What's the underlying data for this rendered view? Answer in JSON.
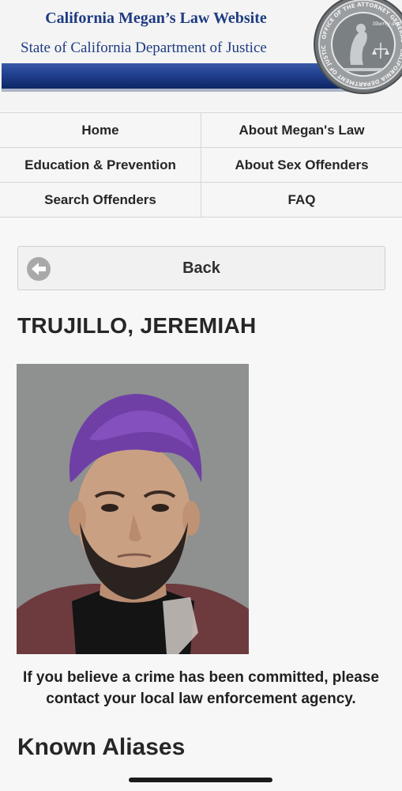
{
  "header": {
    "title": "California Megan’s Law Website",
    "subtitle": "State of California Department of Justice",
    "seal_icon": "attorney-general-seal-icon",
    "seal_ring_text": "OFFICE OF THE ATTORNEY GENERAL · CALIFORNIA DEPARTMENT OF JUSTICE",
    "seal_motto": "liberty and justice under law"
  },
  "nav": {
    "items": [
      {
        "label": "Home"
      },
      {
        "label": "About Megan's Law"
      },
      {
        "label": "Education & Prevention"
      },
      {
        "label": "About Sex Offenders"
      },
      {
        "label": "Search Offenders"
      },
      {
        "label": "FAQ"
      }
    ]
  },
  "back": {
    "label": "Back",
    "icon": "arrow-left-circle-icon"
  },
  "offender": {
    "name": "TRUJILLO, JEREMIAH",
    "photo_icon": "offender-photo"
  },
  "notice": {
    "text": "If you believe a crime has been committed, please contact your local law enforcement agency."
  },
  "aliases": {
    "heading": "Known Aliases"
  },
  "colors": {
    "brand_blue": "#1e3b82",
    "bar_dark": "#0d2764",
    "background": "#f7f7f7"
  }
}
